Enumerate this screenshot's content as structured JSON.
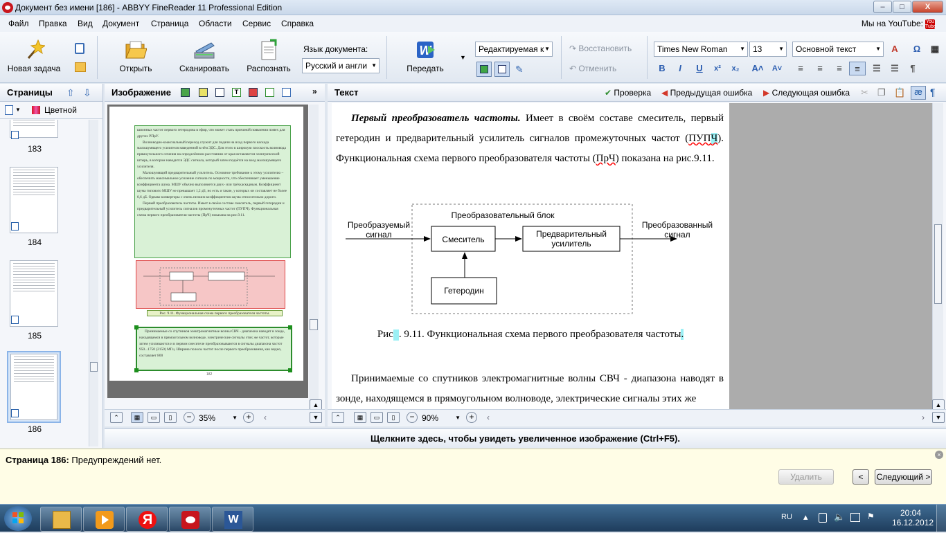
{
  "window": {
    "title": "Документ без имени [186] - ABBYY FineReader 11 Professional Edition",
    "minimize": "–",
    "maximize": "□",
    "close": "X"
  },
  "menu": [
    "Файл",
    "Правка",
    "Вид",
    "Документ",
    "Страница",
    "Области",
    "Сервис",
    "Справка"
  ],
  "youtube_label": "Мы на YouTube:",
  "toolbar": {
    "new_task": "Новая задача",
    "open": "Открыть",
    "scan": "Сканировать",
    "recognize": "Распознать",
    "doc_lang_label": "Язык документа:",
    "doc_lang_value": "Русский и англи",
    "send": "Передать",
    "mode_value": "Редактируемая к",
    "restore": "Восстановить",
    "undo": "Отменить",
    "font_value": "Times New Roman",
    "size_value": "13",
    "style_value": "Основной текст"
  },
  "pages_panel": {
    "title": "Страницы",
    "color_mode": "Цветной",
    "pages": [
      "183",
      "184",
      "185",
      "186"
    ]
  },
  "image_panel": {
    "title": "Изображение",
    "zoom": "35%",
    "page_text_top": "шионных частот первого гетеродина в эфир, что может стать причиной появления помех для других РПрУ.",
    "page_text_1": "Волноводно-коаксиальный переход служит для подачи на вход первого каскада малошумящего усилителя наведенной в нём ЭДС. Для этого в широкую плоскость волновода прямоугольного сечения на определённом расстоянии от края вставляется электрический штырь, в котором наводится ЭДС сигнала, который затем подаётся на вход малошумящего усилителя.",
    "page_text_2": "Малошумящий предварительный усилитель. Основное требование к этому усилителю – обеспечить максимальное усиление сигнала по мощности, что обеспечивает уменьшение коэффициента шума. МШУ обычно выполняется двух- или трёхкаскадным. Коэффициент шума типового МШУ не превышает 1,2 дБ, но есть и такие, у которых он составляет не более 0,6 дБ. Однако конверторы с очень низким коэффициентом шума относительно дороги.",
    "page_text_3": "Первый преобразователь частоты. Имеет в своём составе смеситель, первый гетеродин и предварительный усилитель сигналов промежуточных частот (ПУПЧ). Функциональная схема первого преобразователя частоты (ПрЧ) показана на рис.9.11.",
    "page_caption": "Рис. 9.11. Функциональная схема первого преобразователя частоты.",
    "page_text_4": "Принимаемые со спутников электромагнитные волны СВЧ - диапазона наводят в зонде, находящемся в прямоугольном волноводе, электрические сигналы этих же частот, которые затем усиливаются и в первом смесителе преобразовываются в сигналы диапазона частот 950...1750 (2150) МГц. Ширина полосы частот после первого преобразования, как видно, составляет 800",
    "page_number": "182"
  },
  "text_panel": {
    "title": "Текст",
    "check": "Проверка",
    "prev_error": "Предыдущая ошибка",
    "next_error": "Следующая ошибка",
    "zoom": "90%",
    "para1_bold": "Первый преобразователь частоты.",
    "para1_a": " Имеет в своём составе смеситель, первый гетеродин и предварительный усилитель сигналов промежуточных частот (",
    "para1_pupch_a": "ПУП",
    "para1_pupch_b": "Ч",
    "para1_b": "). Функциональная схема первого преобразователя частоты (",
    "para1_prch": "ПрЧ",
    "para1_c": ") показана на рис.9.11.",
    "caption_a": "Рис",
    "caption_b": ". 9.11. Функциональная схема первого преобразователя частоты",
    "caption_c": ".",
    "para2": "Принимаемые со спутников электромагнитные волны СВЧ - диапазона наводят в зонде, находящемся в прямоугольном волноводе, электрические сигналы этих же"
  },
  "diagram": {
    "block_title": "Преобразовательный блок",
    "input_label_1": "Преобразуемый",
    "input_label_2": "сигнал",
    "mixer": "Смеситель",
    "amp_1": "Предварительный",
    "amp_2": "усилитель",
    "lo": "Гетеродин",
    "output_label_1": "Преобразованный",
    "output_label_2": "сигнал"
  },
  "zoom_hint": "Щелкните здесь, чтобы увидеть увеличенное изображение (Ctrl+F5).",
  "warnings": {
    "page_label": "Страница 186:",
    "message": " Предупреждений нет.",
    "delete": "Удалить",
    "prev": "<",
    "next": "Следующий >"
  },
  "taskbar": {
    "lang": "RU",
    "time": "20:04",
    "date": "16.12.2012"
  }
}
